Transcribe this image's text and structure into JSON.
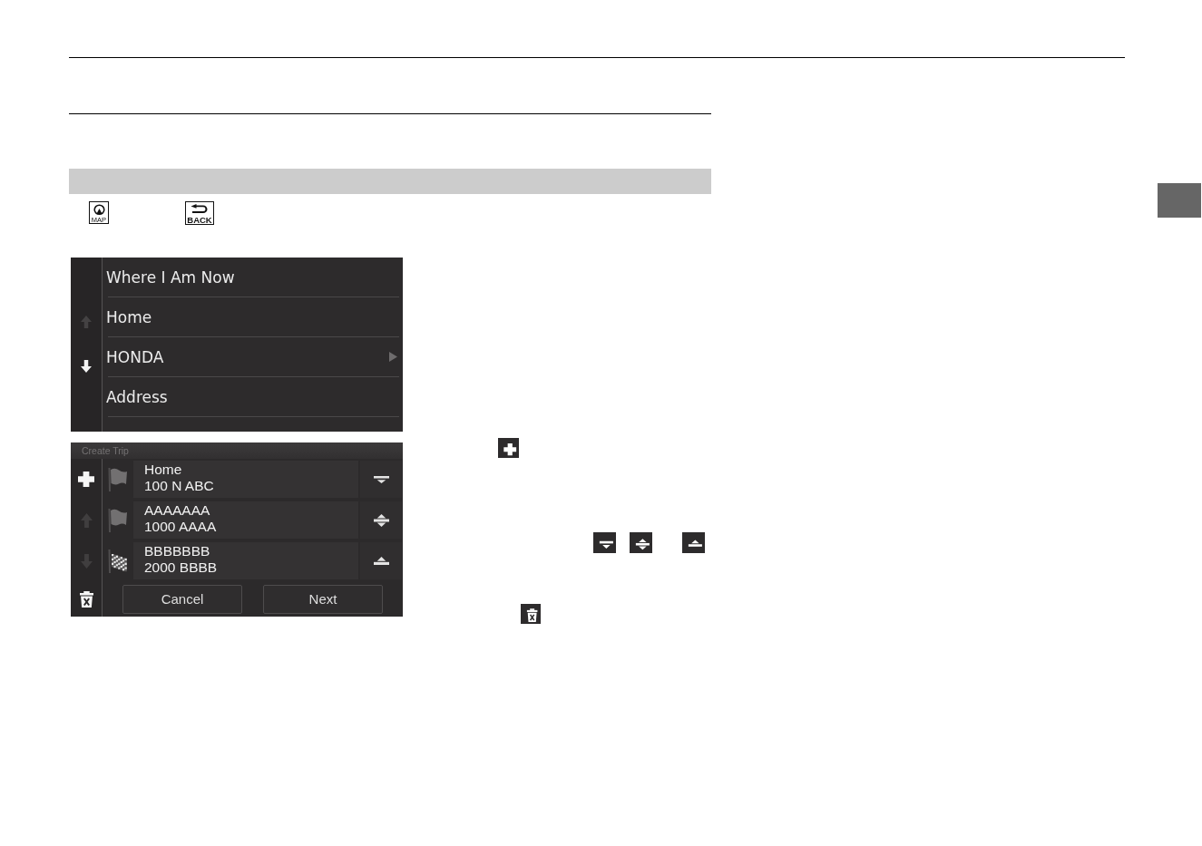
{
  "key_icons": [
    {
      "kind": "map",
      "label": "MAP"
    },
    {
      "kind": "back",
      "label": "BACK"
    }
  ],
  "destination_menu": {
    "scroll_buttons": [
      {
        "kind": "up",
        "disabled": true
      },
      {
        "kind": "down",
        "disabled": false
      }
    ],
    "items": [
      {
        "label": "Where I Am Now",
        "submenu": false
      },
      {
        "label": "Home",
        "submenu": false
      },
      {
        "label": "HONDA",
        "submenu": true
      },
      {
        "label": "Address",
        "submenu": false
      }
    ]
  },
  "create_trip": {
    "title": "Create Trip",
    "side_buttons": [
      {
        "kind": "add",
        "disabled": false
      },
      {
        "kind": "up",
        "disabled": true
      },
      {
        "kind": "down",
        "disabled": true
      },
      {
        "kind": "delete",
        "disabled": false
      }
    ],
    "stops": [
      {
        "kind": "flag",
        "name": "Home",
        "address": "100 N ABC",
        "move_button": {
          "kind": "move_down"
        }
      },
      {
        "kind": "flag",
        "name": "AAAAAAA",
        "address": "1000 AAAA",
        "move_button": {
          "kind": "move_up_down"
        }
      },
      {
        "kind": "finish",
        "name": "BBBBBBB",
        "address": "2000 BBBB",
        "move_button": {
          "kind": "move_up"
        }
      }
    ],
    "buttons": [
      "Cancel",
      "Next"
    ]
  },
  "body_icon_lines": [
    [
      {
        "kind": "add"
      }
    ],
    [
      {
        "kind": "move_down"
      },
      {
        "kind": "move_up_down"
      },
      {
        "kind": "move_up"
      }
    ],
    [
      {
        "kind": "delete"
      }
    ]
  ]
}
